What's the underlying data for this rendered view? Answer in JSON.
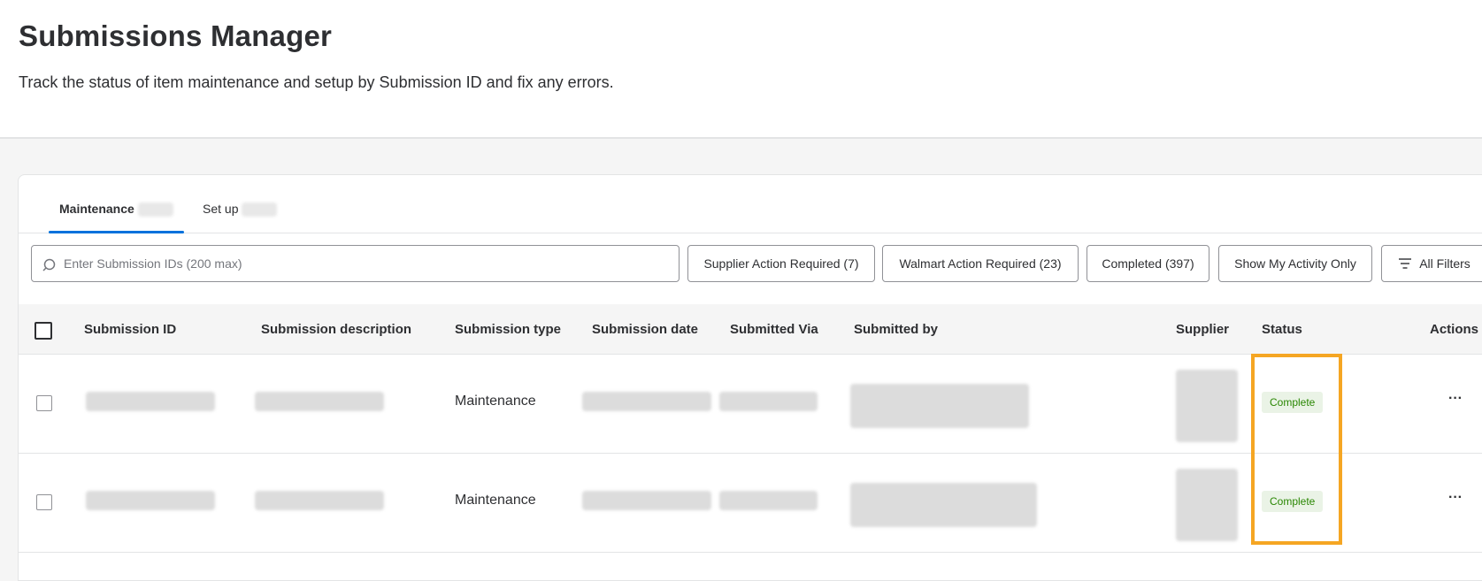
{
  "header": {
    "title": "Submissions Manager",
    "subtitle": "Track the status of item maintenance and setup by Submission ID and fix any errors."
  },
  "tabs": [
    {
      "label": "Maintenance",
      "active": true
    },
    {
      "label": "Set up",
      "active": false
    }
  ],
  "search": {
    "placeholder": "Enter Submission IDs (200 max)",
    "value": ""
  },
  "filters": [
    {
      "label": "Supplier Action Required (7)"
    },
    {
      "label": "Walmart Action Required (23)"
    },
    {
      "label": "Completed (397)"
    },
    {
      "label": "Show My Activity Only"
    },
    {
      "label": "All Filters"
    }
  ],
  "table": {
    "columns": [
      "Submission ID",
      "Submission description",
      "Submission type",
      "Submission date",
      "Submitted Via",
      "Submitted by",
      "Supplier",
      "Status",
      "Actions"
    ],
    "rows": [
      {
        "submission_type": "Maintenance",
        "status": "Complete",
        "actions": "···"
      },
      {
        "submission_type": "Maintenance",
        "status": "Complete",
        "actions": "···"
      }
    ]
  },
  "colors": {
    "accent": "#0071dc",
    "status_complete_bg": "#eaf3e6",
    "status_complete_text": "#2a8703",
    "highlight": "#f5a623"
  },
  "icons": {
    "search": "search-icon",
    "filter": "filter-icon",
    "more": "more-horizontal-icon"
  }
}
